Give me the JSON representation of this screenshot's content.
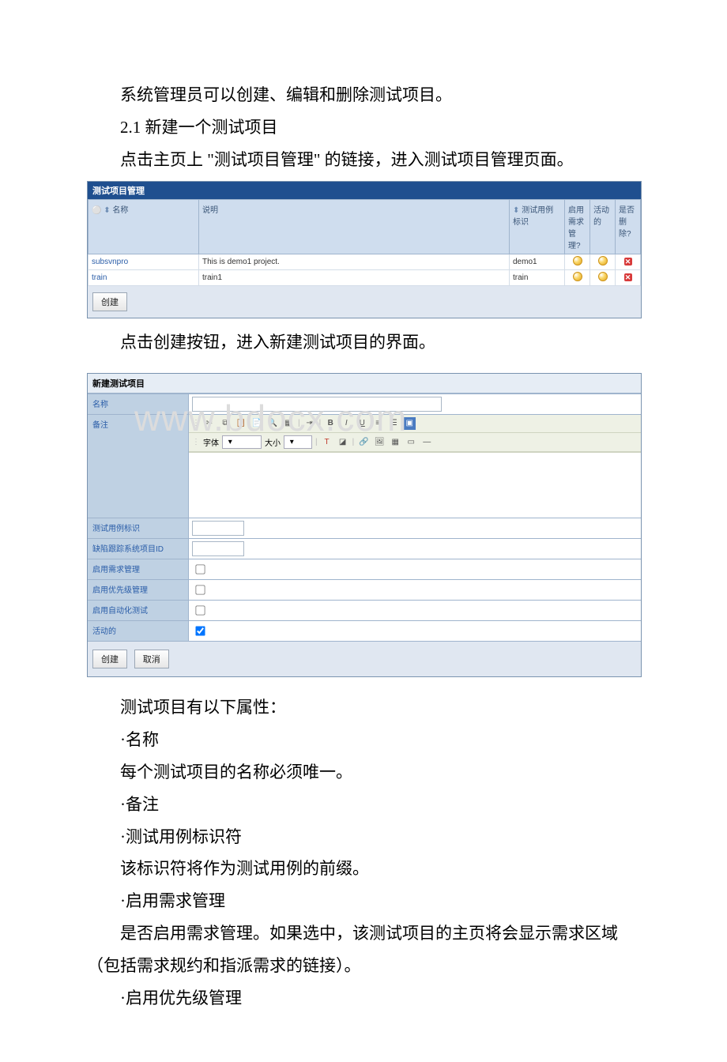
{
  "paragraphs": {
    "p1": "系统管理员可以创建、编辑和删除测试项目。",
    "p2_prefix": "2.1 ",
    "p2": "新建一个测试项目",
    "p3": "点击主页上 \"测试项目管理\" 的链接，进入测试项目管理页面。",
    "p4": "点击创建按钮，进入新建测试项目的界面。",
    "p5": "测试项目有以下属性：",
    "p6": "·名称",
    "p7": "每个测试项目的名称必须唯一。",
    "p8": "·备注",
    "p9": "·测试用例标识符",
    "p10": "该标识符将作为测试用例的前缀。",
    "p11": "·启用需求管理",
    "p12": "是否启用需求管理。如果选中，该测试项目的主页将会显示需求区域（包括需求规约和指派需求的链接）。",
    "p13": "·启用优先级管理"
  },
  "img1": {
    "title": "测试项目管理",
    "cols": {
      "name": "名称",
      "desc": "说明",
      "tcid": "测试用例标识",
      "req": "启用需求管理?",
      "active": "活动的",
      "delete": "是否删除?"
    },
    "sort": "⬍",
    "rows": [
      {
        "name": "subsvnpro",
        "desc": "This is demo1 project.",
        "tcid": "demo1"
      },
      {
        "name": "train",
        "desc": "train1",
        "tcid": "train"
      }
    ],
    "create_btn": "创建"
  },
  "img2": {
    "title": "新建测试项目",
    "labels": {
      "name": "名称",
      "remark": "备注",
      "tcid": "测试用例标识",
      "bugsys": "缺陷跟踪系统项目ID",
      "req": "启用需求管理",
      "priority": "启用优先级管理",
      "auto": "启用自动化测试",
      "active": "活动的"
    },
    "toolbar": {
      "font_label": "字体",
      "size_label": "大小"
    },
    "create_btn": "创建",
    "cancel_btn": "取消",
    "active_checked": true
  },
  "watermark": "www.bdocx.com"
}
